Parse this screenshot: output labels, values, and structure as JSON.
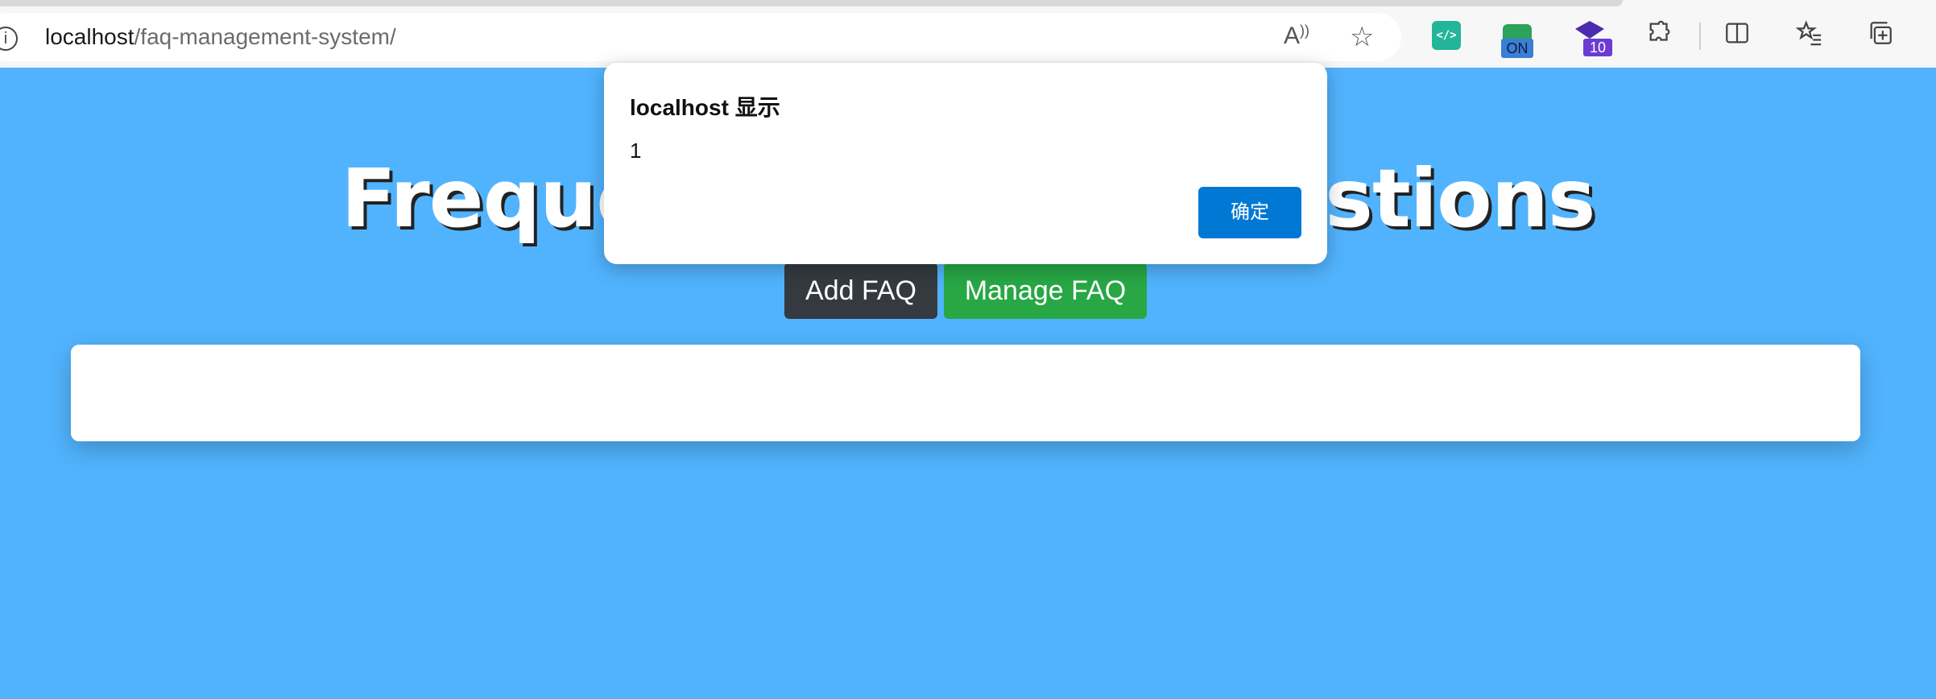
{
  "browser": {
    "url_host": "localhost",
    "url_path": "/faq-management-system/",
    "icons": {
      "info": "info-icon",
      "read_aloud": "read-aloud-icon",
      "favorite": "star-icon",
      "extension_devtools": "devtools-extension-icon",
      "extension_on": "on-extension-icon",
      "extension_cap": "graduation-cap-extension-icon",
      "extensions": "puzzle-icon",
      "split_screen": "split-screen-icon",
      "favorites": "favorites-icon",
      "collections": "collections-icon"
    },
    "extension_on_badge": "ON",
    "extension_cap_badge": "10"
  },
  "page": {
    "heading": "Frequently Asked Questions",
    "add_button": "Add FAQ",
    "manage_button": "Manage FAQ",
    "background_color": "#51b3fd"
  },
  "dialog": {
    "title": "localhost 显示",
    "message": "1",
    "ok_label": "确定",
    "ok_color": "#0078d4"
  }
}
